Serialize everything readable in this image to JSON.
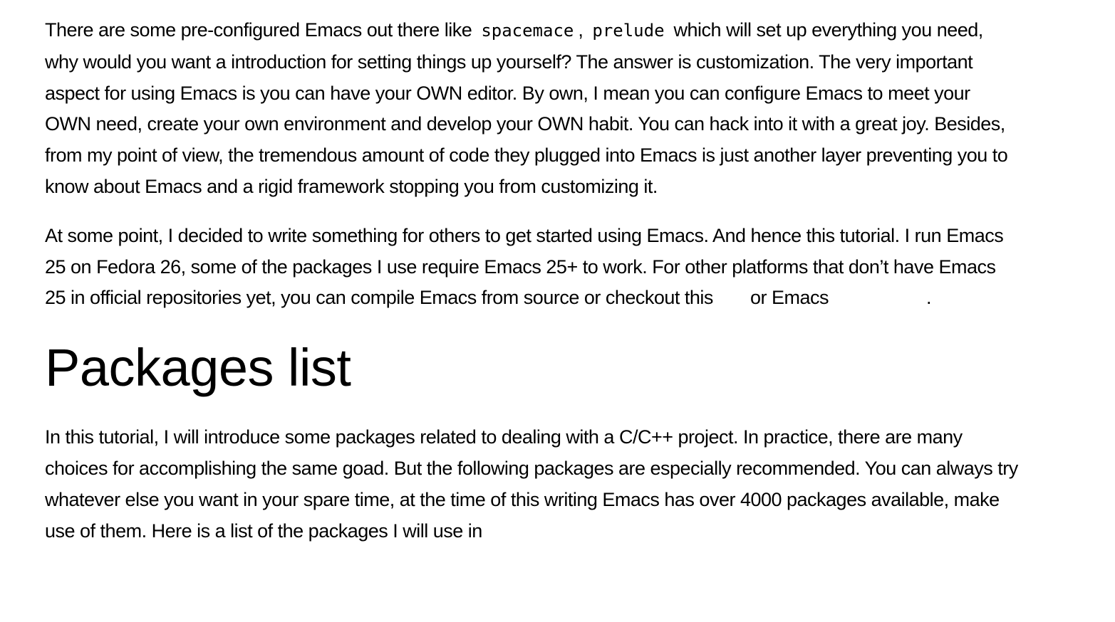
{
  "para1": {
    "t1": "There are some pre-configured Emacs out there like ",
    "code1": "spacemace",
    "t2": ", ",
    "code2": "prelude",
    "t3": " which will set up everything you need, why would you want a introduction for setting things up yourself? The answer is customization. The very important aspect for using Emacs is you can have your OWN editor. By own, I mean you can configure Emacs to meet your OWN need, create your own environment and develop your OWN habit. You can hack into it with a great joy. Besides, from my point of view, the tremendous amount of code they plugged into Emacs is just another layer preventing you to know about Emacs and a rigid framework stopping you from customizing it."
  },
  "para2": {
    "t1": "At some point, I decided to write something for others to get started using Emacs. And hence this tutorial. I run Emacs 25 on Fedora 26, some of the packages I use require Emacs 25+ to work. For other platforms that don’t have Emacs 25 in official repositories yet, you can compile Emacs from source or checkout this",
    "t2": "or Emacs",
    "t3": "."
  },
  "heading": "Packages list",
  "para3": "In this tutorial, I will introduce some packages related to dealing with a C/C++ project. In practice, there are many choices for accomplishing the same goad. But the following packages are especially recommended. You can always try whatever else you want in your spare time, at the time of this writing Emacs has over 4000 packages available, make use of them. Here is a list of the packages I will use in"
}
